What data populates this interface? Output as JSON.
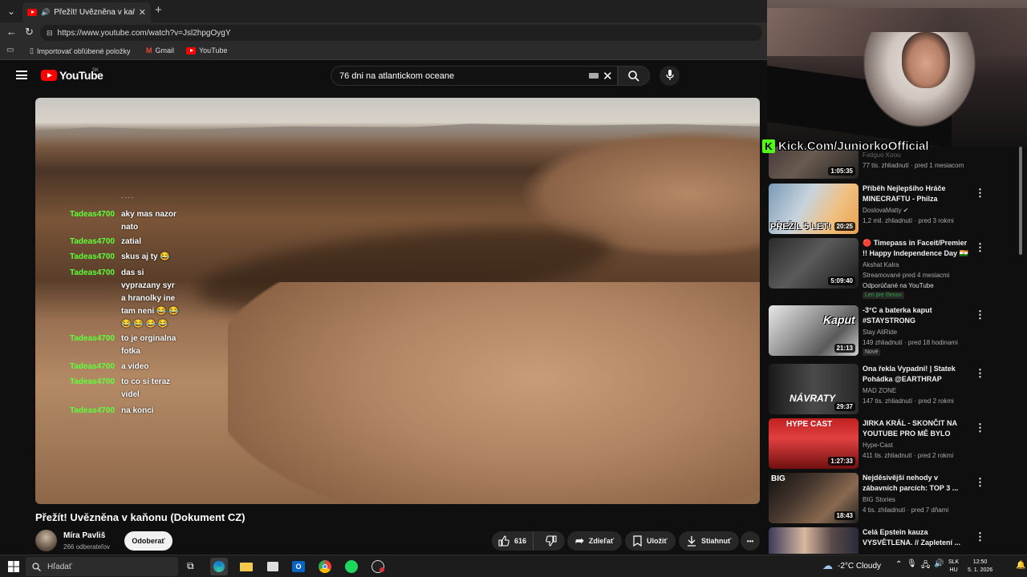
{
  "browser": {
    "tab_title": "Přežít! Uvězněna v kaňonu (D",
    "url": "https://www.youtube.com/watch?v=Jsl2hpgOygY",
    "bookmarks": [
      "Importovať obľúbené položky",
      "Gmail",
      "YouTube"
    ]
  },
  "youtube": {
    "logo_text": "YouTube",
    "region": "SK",
    "search_value": "76 dni na atlantickom oceane"
  },
  "chat": [
    {
      "user": "Tadeas4700",
      "msg": "aky mas nazor nato"
    },
    {
      "user": "Tadeas4700",
      "msg": "zatial"
    },
    {
      "user": "Tadeas4700",
      "msg": "skus aj ty 😂"
    },
    {
      "user": "Tadeas4700",
      "msg": "das si vyprazany syr a hranolky ine tam neni 😂 😂 😂 😂 😂 😂"
    },
    {
      "user": "Tadeas4700",
      "msg": "to je orginalna fotka"
    },
    {
      "user": "Tadeas4700",
      "msg": "a video"
    },
    {
      "user": "Tadeas4700",
      "msg": "to co si teraz videl"
    },
    {
      "user": "Tadeas4700",
      "msg": "na konci"
    }
  ],
  "chat_dots": "- - - -",
  "video": {
    "title": "Přežít! Uvězněna v kaňonu (Dokument CZ)",
    "channel": "Míra Pavliš",
    "subscribers": "266 odberateľov",
    "subscribe_label": "Odoberať",
    "likes": "616",
    "share_label": "Zdieľať",
    "save_label": "Uložiť",
    "download_label": "Stiahnuť",
    "more_label": "•••"
  },
  "overlay": {
    "kick_badge": "K",
    "kick_text": "Kick.Com/JuniorkoOfficial"
  },
  "recommendations": [
    {
      "title": "",
      "channel": "Fatiguo Koou",
      "meta": "77 tis. zhliadnutí · pred 1 mesiacom",
      "duration": "1:05:35",
      "badge": ""
    },
    {
      "title": "Příběh Nejlepšího Hráče MINECRAFTU - Philza",
      "channel": "DoslovaMatty ✔",
      "meta": "1,2 mil. zhliadnutí · pred 3 rokmi",
      "duration": "20:25",
      "badge": "",
      "thumb_text": "PŘEŽIL 5 LET!"
    },
    {
      "title": "🔴 Timepass in Faceit/Premier !! Happy Independence Day 🇮🇳",
      "channel": "Akshat Kalra",
      "meta": "Streamované pred 4 mesiacmi",
      "extra": "Odporúčané na YouTube",
      "duration": "5:09:40",
      "badge": "Len pre členov"
    },
    {
      "title": "-3°C a baterka kaput #STAYSTRONG",
      "channel": "Stay AliRide",
      "meta": "149 zhliadnutí · pred 18 hodinami",
      "duration": "21:13",
      "badge": "Nové",
      "thumb_text": "Kaput"
    },
    {
      "title": "Ona řekla Vypadni! | Statek Pohádka @EARTHRAP",
      "channel": "MAD ZONE",
      "meta": "147 tis. zhliadnutí · pred 2 rokmi",
      "duration": "29:37",
      "badge": "",
      "thumb_text": "NÁVRATY"
    },
    {
      "title": "JIRKA KRÁL - SKONČIT NA YOUTUBE PRO MĚ BYLO TĚŽK...",
      "channel": "Hype-Cast",
      "meta": "411 tis. zhliadnutí · pred 2 rokmi",
      "duration": "1:27:33",
      "badge": "",
      "thumb_text": "HYPE CAST"
    },
    {
      "title": "Nejděsivější nehody v zábavních parcích: TOP 3 ...",
      "channel": "BIG Stories",
      "meta": "4 tis. zhliadnutí · pred 7 dňami",
      "duration": "18:43",
      "badge": "",
      "thumb_text": "BIG"
    },
    {
      "title": "Celá Epstein kauza VYSVĚTLENA. // Zapletení ...",
      "channel": "",
      "meta": "",
      "duration": "",
      "badge": ""
    }
  ],
  "taskbar": {
    "search_placeholder": "Hľadať",
    "weather": "-2°C  Cloudy",
    "lang_1": "SLK",
    "lang_2": "HU",
    "time": "12:50",
    "date": "5. 1. 2026"
  },
  "colors": {
    "chat_user": "#5dff3a",
    "kick_green": "#53fc18",
    "youtube_red": "#ff0000"
  }
}
